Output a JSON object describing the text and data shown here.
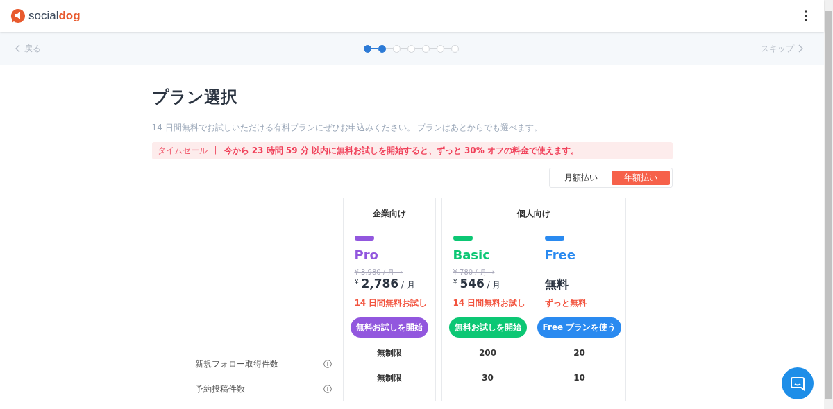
{
  "header": {
    "logo_text_part1": "social",
    "logo_text_part2": "dog"
  },
  "stepper": {
    "back": "戻る",
    "skip": "スキップ",
    "steps": [
      {
        "completed": true
      },
      {
        "completed": true
      },
      {
        "completed": false
      },
      {
        "completed": false
      },
      {
        "completed": false
      },
      {
        "completed": false
      },
      {
        "completed": false
      }
    ]
  },
  "title": "プラン選択",
  "intro": "14 日間無料でお試しいただける有料プランにぜひお申込みください。 プランはあとからでも選べます。",
  "sale_banner": {
    "tag": "タイムセール",
    "separator": "|",
    "message": "今から 23 時間 59 分 以内に無料お試しを開始すると、ずっと 30% オフの料金で使えます。"
  },
  "billing_toggle": [
    {
      "label": "月額払い",
      "selected": false
    },
    {
      "label": "年額払い",
      "selected": true
    }
  ],
  "plan_groups": [
    {
      "label": "企業向け",
      "plans": [
        {
          "name": "Pro",
          "color": "#9257de",
          "kind": "paid",
          "original_price": "¥ 3,980 / 月 →",
          "currency": "¥",
          "price": "2,786",
          "unit": "/ 月",
          "trial": "14 日間無料お試し",
          "button": "無料お試しを開始"
        }
      ]
    },
    {
      "label": "個人向け",
      "plans": [
        {
          "name": "Basic",
          "color": "#0cc774",
          "kind": "paid",
          "original_price": "¥ 780 / 月 →",
          "currency": "¥",
          "price": "546",
          "unit": "/ 月",
          "trial": "14 日間無料お試し",
          "button": "無料お試しを開始"
        },
        {
          "name": "Free",
          "color": "#2a8af0",
          "kind": "free",
          "price": "無料",
          "trial": "ずっと無料",
          "button": "Free プランを使う"
        }
      ]
    }
  ],
  "features": [
    {
      "label": "新規フォロー取得件数",
      "values": [
        "無制限",
        "200",
        "20"
      ]
    },
    {
      "label": "予約投稿件数",
      "values": [
        "無制限",
        "30",
        "10"
      ]
    }
  ]
}
